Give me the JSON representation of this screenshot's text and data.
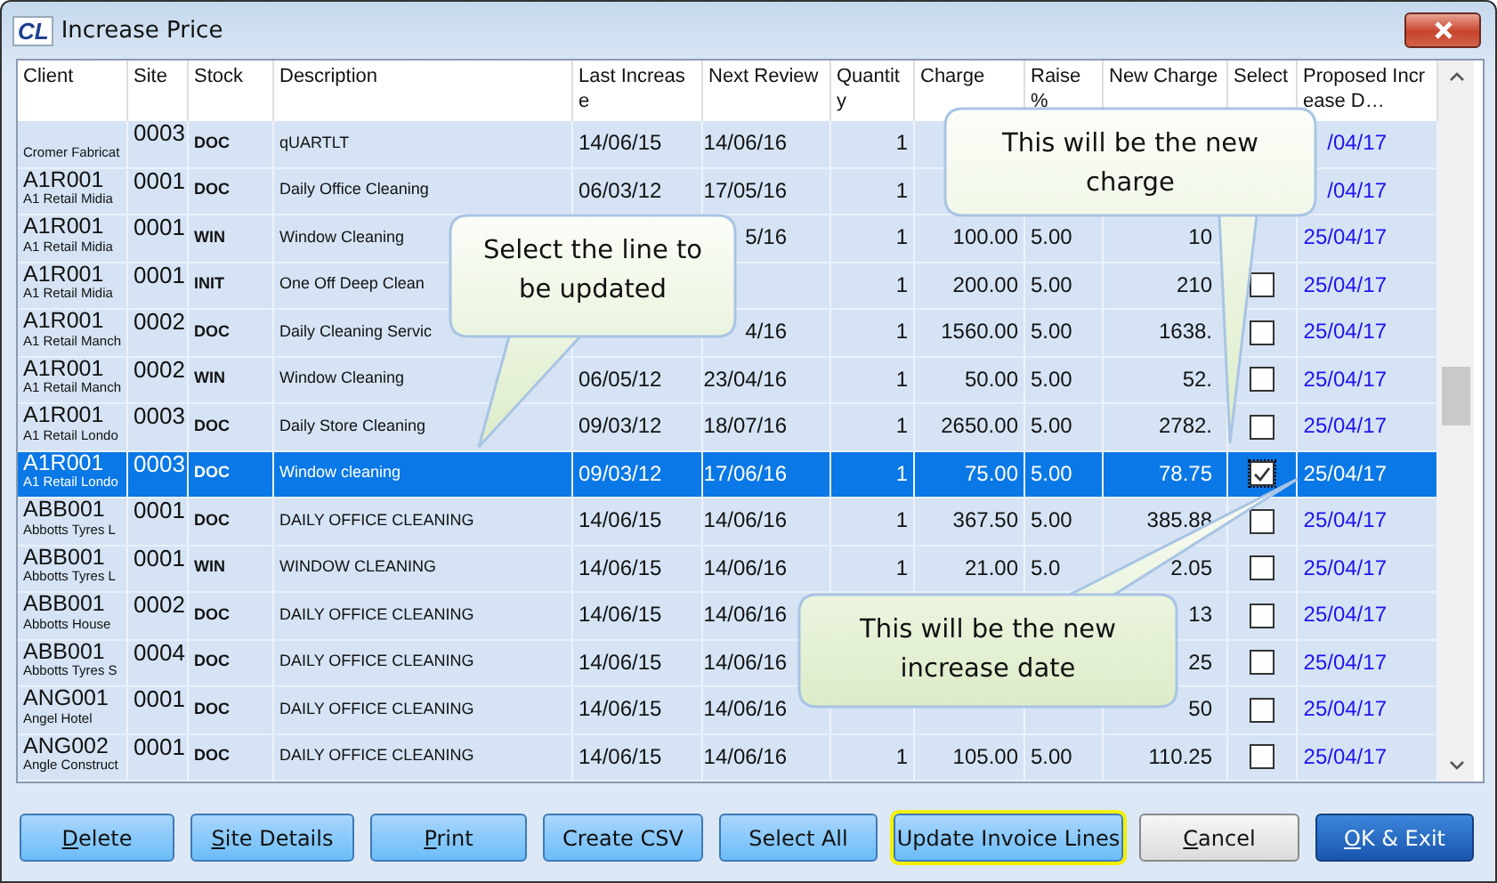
{
  "window": {
    "logo": "CL",
    "title": "Increase Price"
  },
  "table": {
    "columns": [
      "Client",
      "Site",
      "Stock",
      "Description",
      "Last Increase",
      "Next Review",
      "Quantity",
      "Charge",
      "Raise %",
      "New Charge",
      "Select",
      "Proposed Increase D…"
    ],
    "rows": [
      {
        "client_name": "Cromer Fabricat",
        "site": "0003",
        "stock": "DOC",
        "description": "qUARTLT",
        "last_increase": "14/06/15",
        "next_review": "14/06/16",
        "quantity": "1",
        "proposed_date": "/04/17",
        "selected": false
      },
      {
        "client": "A1R001",
        "client_name": "A1 Retail Midia",
        "site": "0001",
        "stock": "DOC",
        "description": "Daily Office Cleaning",
        "last_increase": "06/03/12",
        "next_review": "17/05/16",
        "quantity": "1",
        "proposed_date": "/04/17",
        "selected": false
      },
      {
        "client": "A1R001",
        "client_name": "A1 Retail Midia",
        "site": "0001",
        "stock": "WIN",
        "description": "Window Cleaning",
        "next_review": "5/16",
        "quantity": "1",
        "charge": "100.00",
        "raise": "5.00",
        "new_charge": "10",
        "proposed_date": "25/04/17",
        "selected": false
      },
      {
        "client": "A1R001",
        "client_name": "A1 Retail Midia",
        "site": "0001",
        "stock": "INIT",
        "description": "One Off Deep Clean",
        "quantity": "1",
        "charge": "200.00",
        "raise": "5.00",
        "new_charge": "210",
        "checked": false,
        "proposed_date": "25/04/17",
        "selected": false
      },
      {
        "client": "A1R001",
        "client_name": "A1 Retail Manch",
        "site": "0002",
        "stock": "DOC",
        "description": "Daily  Cleaning Servic",
        "next_review": "4/16",
        "quantity": "1",
        "charge": "1560.00",
        "raise": "5.00",
        "new_charge": "1638.",
        "checked": false,
        "proposed_date": "25/04/17",
        "selected": false
      },
      {
        "client": "A1R001",
        "client_name": "A1 Retail Manch",
        "site": "0002",
        "stock": "WIN",
        "description": "Window Cleaning",
        "last_increase": "06/05/12",
        "next_review": "23/04/16",
        "quantity": "1",
        "charge": "50.00",
        "raise": "5.00",
        "new_charge": "52.",
        "checked": false,
        "proposed_date": "25/04/17",
        "selected": false
      },
      {
        "client": "A1R001",
        "client_name": "A1 Retail Londo",
        "site": "0003",
        "stock": "DOC",
        "description": "Daily Store Cleaning",
        "last_increase": "09/03/12",
        "next_review": "18/07/16",
        "quantity": "1",
        "charge": "2650.00",
        "raise": "5.00",
        "new_charge": "2782.",
        "checked": false,
        "proposed_date": "25/04/17",
        "selected": false
      },
      {
        "client": "A1R001",
        "client_name": "A1 Retail Londo",
        "site": "0003",
        "stock": "DOC",
        "description": "Window cleaning",
        "last_increase": "09/03/12",
        "next_review": "17/06/16",
        "quantity": "1",
        "charge": "75.00",
        "raise": "5.00",
        "new_charge": "78.75",
        "checked": true,
        "proposed_date": "25/04/17",
        "selected": true
      },
      {
        "client": "ABB001",
        "client_name": "Abbotts Tyres L",
        "site": "0001",
        "stock": "DOC",
        "description": "DAILY OFFICE CLEANING",
        "last_increase": "14/06/15",
        "next_review": "14/06/16",
        "quantity": "1",
        "charge": "367.50",
        "raise": "5.00",
        "new_charge": "385.88",
        "checked": false,
        "proposed_date": "25/04/17",
        "selected": false
      },
      {
        "client": "ABB001",
        "client_name": "Abbotts Tyres L",
        "site": "0001",
        "stock": "WIN",
        "description": "WINDOW CLEANING",
        "last_increase": "14/06/15",
        "next_review": "14/06/16",
        "quantity": "1",
        "charge": "21.00",
        "raise": "5.0",
        "new_charge": "2.05",
        "checked": false,
        "proposed_date": "25/04/17",
        "selected": false
      },
      {
        "client": "ABB001",
        "client_name": "Abbotts House",
        "site": "0002",
        "stock": "DOC",
        "description": "DAILY OFFICE CLEANING",
        "last_increase": "14/06/15",
        "next_review": "14/06/16",
        "new_charge": "13",
        "checked": false,
        "proposed_date": "25/04/17",
        "selected": false
      },
      {
        "client": "ABB001",
        "client_name": "Abbotts Tyres S",
        "site": "0004",
        "stock": "DOC",
        "description": "DAILY OFFICE CLEANING",
        "last_increase": "14/06/15",
        "next_review": "14/06/16",
        "new_charge": "25",
        "checked": false,
        "proposed_date": "25/04/17",
        "selected": false
      },
      {
        "client": "ANG001",
        "client_name": "Angel Hotel",
        "site": "0001",
        "stock": "DOC",
        "description": "DAILY OFFICE CLEANING",
        "last_increase": "14/06/15",
        "next_review": "14/06/16",
        "new_charge": "50",
        "checked": false,
        "proposed_date": "25/04/17",
        "selected": false
      },
      {
        "client": "ANG002",
        "client_name": "Angle Construct",
        "site": "0001",
        "stock": "DOC",
        "description": "DAILY OFFICE CLEANING",
        "last_increase": "14/06/15",
        "next_review": "14/06/16",
        "quantity": "1",
        "charge": "105.00",
        "raise": "5.00",
        "new_charge": "110.25",
        "checked": false,
        "proposed_date": "25/04/17",
        "selected": false
      }
    ]
  },
  "callouts": [
    {
      "text": "Select the line to be updated"
    },
    {
      "text": "This will be the new charge"
    },
    {
      "text": "This will be the new increase date"
    }
  ],
  "buttons": [
    {
      "access_key": "D",
      "rest": "elete",
      "kind": "normal"
    },
    {
      "access_key": "S",
      "rest": "ite Details",
      "kind": "normal"
    },
    {
      "access_key": "P",
      "rest": "rint",
      "kind": "normal"
    },
    {
      "rest": "Create CSV",
      "kind": "normal"
    },
    {
      "rest": "Select All",
      "kind": "normal"
    },
    {
      "rest": "Update Invoice Lines",
      "kind": "focused"
    },
    {
      "access_key": "C",
      "rest": "ancel",
      "kind": "neutral"
    },
    {
      "access_key": "O",
      "rest": "K & Exit",
      "kind": "primary"
    }
  ]
}
